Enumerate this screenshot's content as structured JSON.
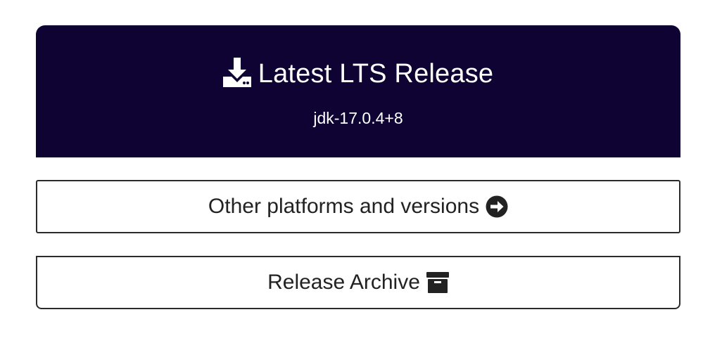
{
  "lts": {
    "title": "Latest LTS Release",
    "version": "jdk-17.0.4+8",
    "icon": "download-icon",
    "background": "#0e0333"
  },
  "other_platforms": {
    "label": "Other platforms and versions",
    "icon": "arrow-circle-right-icon"
  },
  "archive": {
    "label": "Release Archive",
    "icon": "archive-box-icon"
  }
}
